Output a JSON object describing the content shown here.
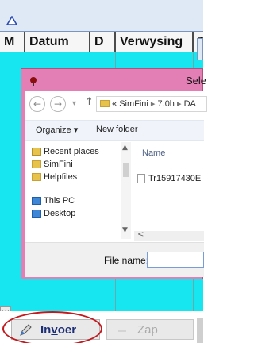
{
  "grid": {
    "columns": [
      "M",
      "Datum",
      "D",
      "Verwysing",
      "T"
    ]
  },
  "dialog": {
    "title": "Sele",
    "address": {
      "prefix": "«",
      "crumbs": [
        "SimFini",
        "7.0h",
        "DA"
      ],
      "sep": "▸"
    },
    "toolbar": {
      "organize": "Organize ▾",
      "new_folder": "New folder"
    },
    "nav_items": [
      "Recent places",
      "SimFini",
      "Helpfiles",
      "This PC",
      "Desktop"
    ],
    "file_column": "Name",
    "files": [
      "Tr15917430E"
    ],
    "file_name_label": "File name:",
    "file_name_value": ""
  },
  "buttons": {
    "invoer": "Invoer",
    "zap": "Zap"
  },
  "colors": {
    "grid_bg": "#17e5ef",
    "dialog_frame": "#e37fb5",
    "annotation": "#c2191f"
  }
}
